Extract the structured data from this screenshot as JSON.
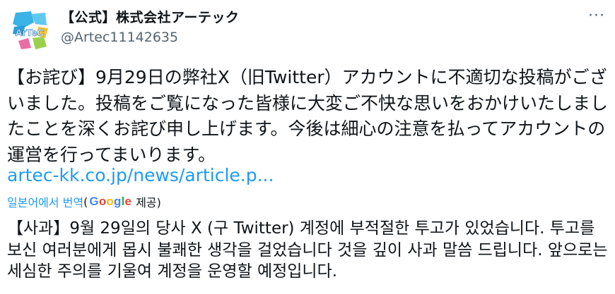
{
  "colors": {
    "accent": "#1d9bf0",
    "text": "#0f1419",
    "muted": "#536471"
  },
  "author": {
    "display_name": "【公式】株式会社アーテック",
    "handle": "@Artec11142635",
    "avatar_text": "ArTeC",
    "avatar_icon": "artec-logo-icon"
  },
  "actions": {
    "more_label": "···",
    "more_icon": "more-options-icon"
  },
  "post": {
    "text": "【お詫び】9月29日の弊社X（旧Twitter）アカウントに不適切な投稿がございました。投稿をご覧になった皆様に大変ご不快な思いをおかけいたしましたことを深くお詫び申し上げます。今後は細心の注意を払ってアカウントの運営を行ってまいります。",
    "link": "artec-kk.co.jp/news/article.p..."
  },
  "translation": {
    "label": "일본어에서 번역",
    "open_paren": "(",
    "provider_letters": [
      "G",
      "o",
      "o",
      "g",
      "l",
      "e"
    ],
    "provider_colors": [
      "#4285F4",
      "#EA4335",
      "#FBBC05",
      "#4285F4",
      "#34A853",
      "#EA4335"
    ],
    "provided_suffix": "제공)",
    "text": "【사과】9월 29일의 당사 X (구 Twitter) 계정에 부적절한 투고가 있었습니다. 투고를 보신 여러분에게 몹시 불쾌한 생각을 걸었습니다 것을 깊이 사과 말씀 드립니다. 앞으로는 세심한 주의를 기울여 계정을 운영할 예정입니다."
  }
}
